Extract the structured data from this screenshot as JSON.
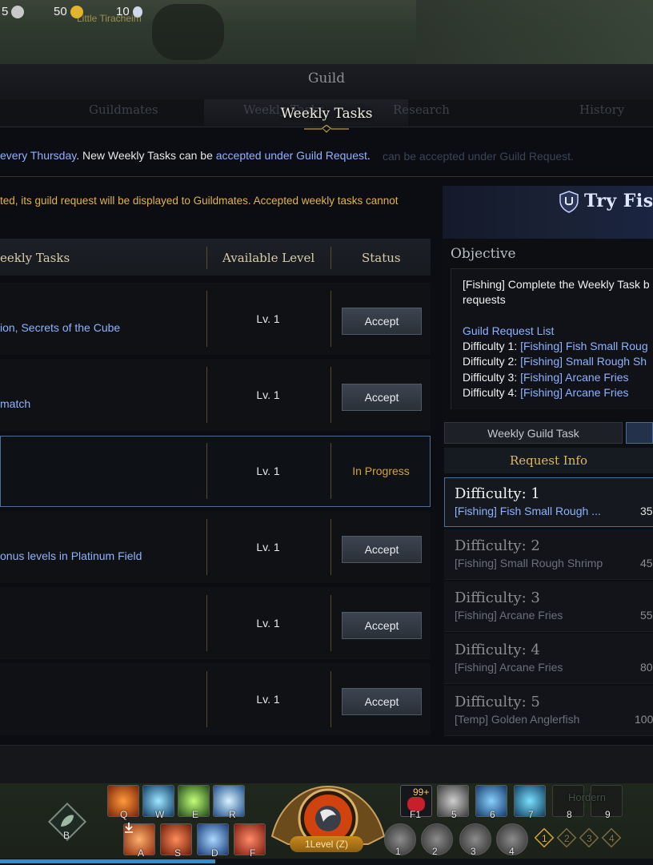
{
  "hud": {
    "currency1": "5",
    "currency2": "50",
    "currency3": "10",
    "overhead_name": "Little Tiracheim"
  },
  "guild": {
    "title": "Guild",
    "tabs": [
      "Guildmates",
      "Weekly Tasks",
      "Research",
      "History"
    ],
    "overlay_title": "Weekly Tasks"
  },
  "info": {
    "line1_a": "every Thursday",
    "line1_b": ". New Weekly Tasks can be ",
    "line1_c": "accepted under Guild Request",
    "line1_d": ".",
    "line1_ghost": "can be accepted under Guild Request.",
    "line2": "ted, its guild request will be displayed to Guildmates. Accepted weekly tasks cannot"
  },
  "table": {
    "headers": [
      "eekly Tasks",
      "Available Level",
      "Status"
    ],
    "rows": [
      {
        "name": "ion, Secrets of the Cube",
        "level": "Lv. 1",
        "status": "Accept"
      },
      {
        "name": "match",
        "level": "Lv. 1",
        "status": "Accept"
      },
      {
        "name": "",
        "level": "Lv. 1",
        "status": "In Progress"
      },
      {
        "name": "onus levels in Platinum Field",
        "level": "Lv. 1",
        "status": "Accept"
      },
      {
        "name": "",
        "level": "Lv. 1",
        "status": "Accept"
      },
      {
        "name": "",
        "level": "Lv. 1",
        "status": "Accept"
      }
    ]
  },
  "panel": {
    "title": "Try Fish",
    "objective_heading": "Objective",
    "objective_line1": "[Fishing] Complete the Weekly Task b",
    "objective_line2": "requests",
    "guild_request_list": "Guild Request List",
    "difficulties_list": [
      {
        "label": "Difficulty 1: ",
        "task": "[Fishing] Fish Small Roug"
      },
      {
        "label": "Difficulty 2: ",
        "task": "[Fishing] Small Rough Sh"
      },
      {
        "label": "Difficulty 3: ",
        "task": "[Fishing] Arcane Fries"
      },
      {
        "label": "Difficulty 4: ",
        "task": "[Fishing] Arcane Fries"
      }
    ],
    "subtab_weekly": "Weekly Guild Task",
    "request_info": "Request Info",
    "requests": [
      {
        "title": "Difficulty: 1",
        "task": "[Fishing] Fish Small Rough ...",
        "amount": "35"
      },
      {
        "title": "Difficulty: 2",
        "task": "[Fishing] Small Rough Shrimp",
        "amount": "45"
      },
      {
        "title": "Difficulty: 3",
        "task": "[Fishing] Arcane Fries",
        "amount": "55"
      },
      {
        "title": "Difficulty: 4",
        "task": "[Fishing] Arcane Fries",
        "amount": "80"
      },
      {
        "title": "Difficulty: 5",
        "task": "[Temp] Golden Anglerfish",
        "amount": "100"
      }
    ]
  },
  "skillbar": {
    "keys_top": [
      "Q",
      "W",
      "E",
      "R",
      "F1",
      "5",
      "6",
      "7",
      "8",
      "9"
    ],
    "keys_bottom": [
      "A",
      "S",
      "D",
      "F",
      "1",
      "2",
      "3",
      "4"
    ],
    "mount_key": "B",
    "potion_count": "99+",
    "level_button": "1Level (Z)",
    "right_marks": [
      "1",
      "2",
      "3",
      "4"
    ],
    "ghost_text": "Hordern",
    "xp_fraction": 0.33
  }
}
